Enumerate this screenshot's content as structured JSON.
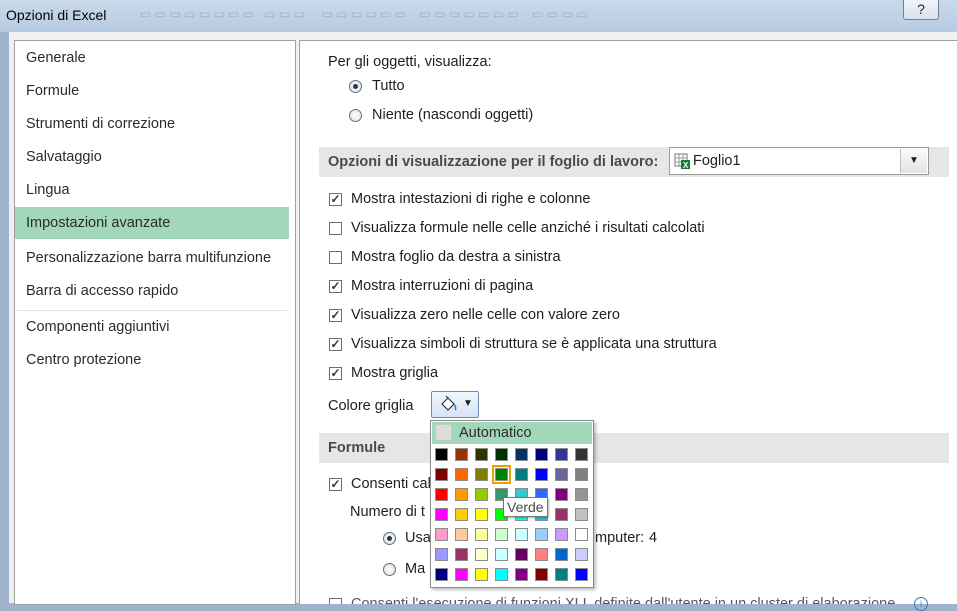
{
  "window": {
    "title": "Opzioni di Excel",
    "help_label": "?"
  },
  "nav": {
    "items": [
      {
        "label": "Generale"
      },
      {
        "label": "Formule"
      },
      {
        "label": "Strumenti di correzione"
      },
      {
        "label": "Salvataggio"
      },
      {
        "label": "Lingua"
      },
      {
        "label": "Impostazioni avanzate",
        "active": true
      },
      {
        "label": "Personalizzazione barra multifunzione"
      },
      {
        "label": "Barra di accesso rapido"
      },
      {
        "label": "Componenti aggiuntivi"
      },
      {
        "label": "Centro protezione"
      }
    ]
  },
  "objects": {
    "heading": "Per gli oggetti, visualizza:",
    "opt_all": "Tutto",
    "opt_none": "Niente (nascondi oggetti)",
    "selected": "Tutto"
  },
  "sheet_options": {
    "header": "Opzioni di visualizzazione per il foglio di lavoro:",
    "sheet_value": "Foglio1",
    "items": [
      {
        "label": "Mostra intestazioni di righe e colonne",
        "checked": true
      },
      {
        "label": "Visualizza formule nelle celle anziché i risultati calcolati",
        "checked": false
      },
      {
        "label": "Mostra foglio da destra a sinistra",
        "checked": false
      },
      {
        "label": "Mostra interruzioni di pagina",
        "checked": true
      },
      {
        "label": "Visualizza zero nelle celle con valore zero",
        "checked": true
      },
      {
        "label": "Visualizza simboli di struttura se è applicata una struttura",
        "checked": true
      },
      {
        "label": "Mostra griglia",
        "checked": true
      }
    ],
    "grid_color_label": "Colore griglia"
  },
  "formulas": {
    "header": "Formule",
    "enable_calc_label": "Consenti cal",
    "threads_label": "Numero di t",
    "use_all_label": "Usa",
    "computer_label": "mputer:",
    "computer_value": "4",
    "manual_label": "Ma",
    "xll_label": "Consenti l'esecuzione di funzioni XLL definite dall'utente in un cluster di elaborazione"
  },
  "palette": {
    "auto_label": "Automatico",
    "tooltip": "Verde",
    "selected": "#008000",
    "rows": [
      [
        "#000000",
        "#993300",
        "#333300",
        "#003300",
        "#003366",
        "#000080",
        "#333399",
        "#333333"
      ],
      [
        "#800000",
        "#FF6600",
        "#808000",
        "#008000",
        "#008080",
        "#0000FF",
        "#666699",
        "#808080"
      ],
      [
        "#FF0000",
        "#FF9900",
        "#99CC00",
        "#339966",
        "#33CCCC",
        "#3366FF",
        "#800080",
        "#969696"
      ],
      [
        "#FF00FF",
        "#FFCC00",
        "#FFFF00",
        "#00FF00",
        "#00FFFF",
        "#00CCFF",
        "#993366",
        "#C0C0C0"
      ],
      [
        "#FF99CC",
        "#FFCC99",
        "#FFFF99",
        "#CCFFCC",
        "#CCFFFF",
        "#99CCFF",
        "#CC99FF",
        "#FFFFFF"
      ],
      [
        "#9999FF",
        "#993366",
        "#FFFFCC",
        "#CCFFFF",
        "#660066",
        "#FF8080",
        "#0066CC",
        "#CCCCFF"
      ],
      [
        "#000080",
        "#FF00FF",
        "#FFFF00",
        "#00FFFF",
        "#800080",
        "#800000",
        "#008080",
        "#0000FF"
      ]
    ]
  },
  "colors": {
    "accent": "#A3D7B9",
    "section_bg": "#E6E6E6",
    "check": "#24385A"
  }
}
